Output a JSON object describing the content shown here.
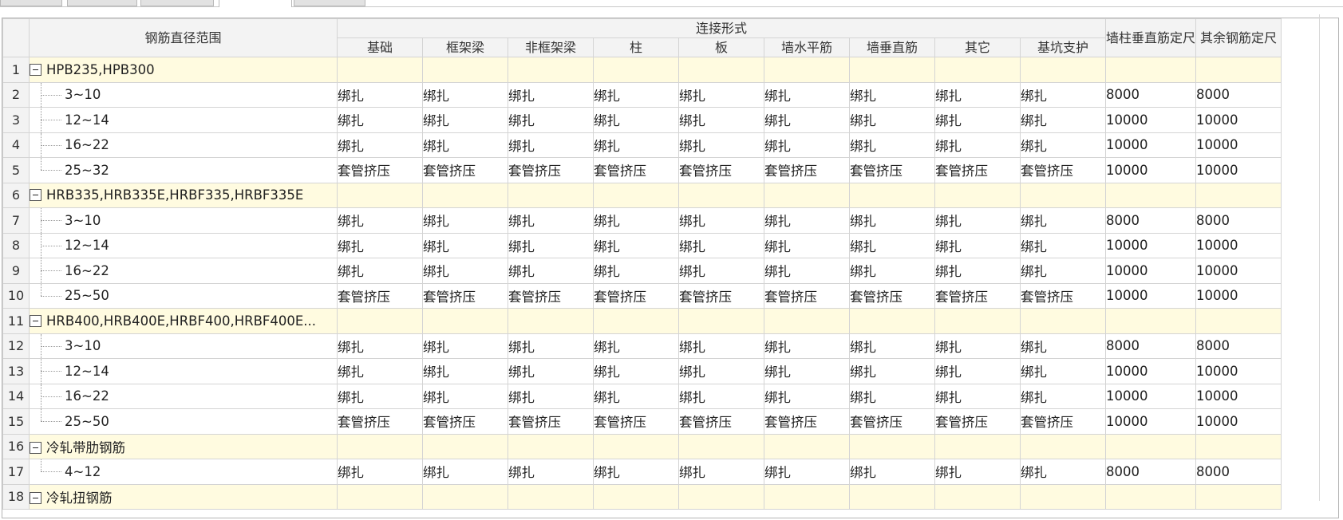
{
  "tabs": [
    {
      "label": ""
    },
    {
      "label": ""
    },
    {
      "label": ""
    },
    {
      "label": ""
    },
    {
      "label": ""
    }
  ],
  "grid": {
    "header": {
      "col_range": "钢筋直径范围",
      "col_connection": "连接形式",
      "connection_columns": [
        "基础",
        "框架梁",
        "非框架梁",
        "柱",
        "板",
        "墙水平筋",
        "墙垂直筋",
        "其它",
        "基坑支护"
      ],
      "col_wall_vertical": "墙柱垂直筋定尺",
      "col_other_fixed": "其余钢筋定尺"
    },
    "rows": [
      {
        "num": "1",
        "type": "group",
        "name": "HPB235,HPB300",
        "values": [
          "",
          "",
          "",
          "",
          "",
          "",
          "",
          "",
          "",
          "",
          ""
        ]
      },
      {
        "num": "2",
        "type": "child",
        "name": "3~10",
        "values": [
          "绑扎",
          "绑扎",
          "绑扎",
          "绑扎",
          "绑扎",
          "绑扎",
          "绑扎",
          "绑扎",
          "绑扎",
          "8000",
          "8000"
        ]
      },
      {
        "num": "3",
        "type": "child",
        "name": "12~14",
        "values": [
          "绑扎",
          "绑扎",
          "绑扎",
          "绑扎",
          "绑扎",
          "绑扎",
          "绑扎",
          "绑扎",
          "绑扎",
          "10000",
          "10000"
        ]
      },
      {
        "num": "4",
        "type": "child",
        "name": "16~22",
        "values": [
          "绑扎",
          "绑扎",
          "绑扎",
          "绑扎",
          "绑扎",
          "绑扎",
          "绑扎",
          "绑扎",
          "绑扎",
          "10000",
          "10000"
        ]
      },
      {
        "num": "5",
        "type": "child-last",
        "name": "25~32",
        "values": [
          "套管挤压",
          "套管挤压",
          "套管挤压",
          "套管挤压",
          "套管挤压",
          "套管挤压",
          "套管挤压",
          "套管挤压",
          "套管挤压",
          "10000",
          "10000"
        ]
      },
      {
        "num": "6",
        "type": "group",
        "name": "HRB335,HRB335E,HRBF335,HRBF335E",
        "values": [
          "",
          "",
          "",
          "",
          "",
          "",
          "",
          "",
          "",
          "",
          ""
        ]
      },
      {
        "num": "7",
        "type": "child",
        "name": "3~10",
        "values": [
          "绑扎",
          "绑扎",
          "绑扎",
          "绑扎",
          "绑扎",
          "绑扎",
          "绑扎",
          "绑扎",
          "绑扎",
          "8000",
          "8000"
        ]
      },
      {
        "num": "8",
        "type": "child",
        "name": "12~14",
        "values": [
          "绑扎",
          "绑扎",
          "绑扎",
          "绑扎",
          "绑扎",
          "绑扎",
          "绑扎",
          "绑扎",
          "绑扎",
          "10000",
          "10000"
        ]
      },
      {
        "num": "9",
        "type": "child",
        "name": "16~22",
        "values": [
          "绑扎",
          "绑扎",
          "绑扎",
          "绑扎",
          "绑扎",
          "绑扎",
          "绑扎",
          "绑扎",
          "绑扎",
          "10000",
          "10000"
        ]
      },
      {
        "num": "10",
        "type": "child-last",
        "name": "25~50",
        "values": [
          "套管挤压",
          "套管挤压",
          "套管挤压",
          "套管挤压",
          "套管挤压",
          "套管挤压",
          "套管挤压",
          "套管挤压",
          "套管挤压",
          "10000",
          "10000"
        ]
      },
      {
        "num": "11",
        "type": "group",
        "name": "HRB400,HRB400E,HRBF400,HRBF400E...",
        "values": [
          "",
          "",
          "",
          "",
          "",
          "",
          "",
          "",
          "",
          "",
          ""
        ]
      },
      {
        "num": "12",
        "type": "child",
        "name": "3~10",
        "values": [
          "绑扎",
          "绑扎",
          "绑扎",
          "绑扎",
          "绑扎",
          "绑扎",
          "绑扎",
          "绑扎",
          "绑扎",
          "8000",
          "8000"
        ]
      },
      {
        "num": "13",
        "type": "child",
        "name": "12~14",
        "values": [
          "绑扎",
          "绑扎",
          "绑扎",
          "绑扎",
          "绑扎",
          "绑扎",
          "绑扎",
          "绑扎",
          "绑扎",
          "10000",
          "10000"
        ]
      },
      {
        "num": "14",
        "type": "child",
        "name": "16~22",
        "values": [
          "绑扎",
          "绑扎",
          "绑扎",
          "绑扎",
          "绑扎",
          "绑扎",
          "绑扎",
          "绑扎",
          "绑扎",
          "10000",
          "10000"
        ]
      },
      {
        "num": "15",
        "type": "child-last",
        "name": "25~50",
        "values": [
          "套管挤压",
          "套管挤压",
          "套管挤压",
          "套管挤压",
          "套管挤压",
          "套管挤压",
          "套管挤压",
          "套管挤压",
          "套管挤压",
          "10000",
          "10000"
        ]
      },
      {
        "num": "16",
        "type": "group",
        "name": "冷轧带肋钢筋",
        "values": [
          "",
          "",
          "",
          "",
          "",
          "",
          "",
          "",
          "",
          "",
          ""
        ]
      },
      {
        "num": "17",
        "type": "child-last",
        "name": "4~12",
        "values": [
          "绑扎",
          "绑扎",
          "绑扎",
          "绑扎",
          "绑扎",
          "绑扎",
          "绑扎",
          "绑扎",
          "绑扎",
          "8000",
          "8000"
        ]
      },
      {
        "num": "18",
        "type": "group",
        "name": "冷轧扭钢筋",
        "values": [
          "",
          "",
          "",
          "",
          "",
          "",
          "",
          "",
          "",
          "",
          ""
        ]
      }
    ]
  },
  "colors": {
    "group_row_bg": "#fffbe0",
    "header_bg": "#f3f3f3",
    "grid_line": "#d4d4d4"
  }
}
